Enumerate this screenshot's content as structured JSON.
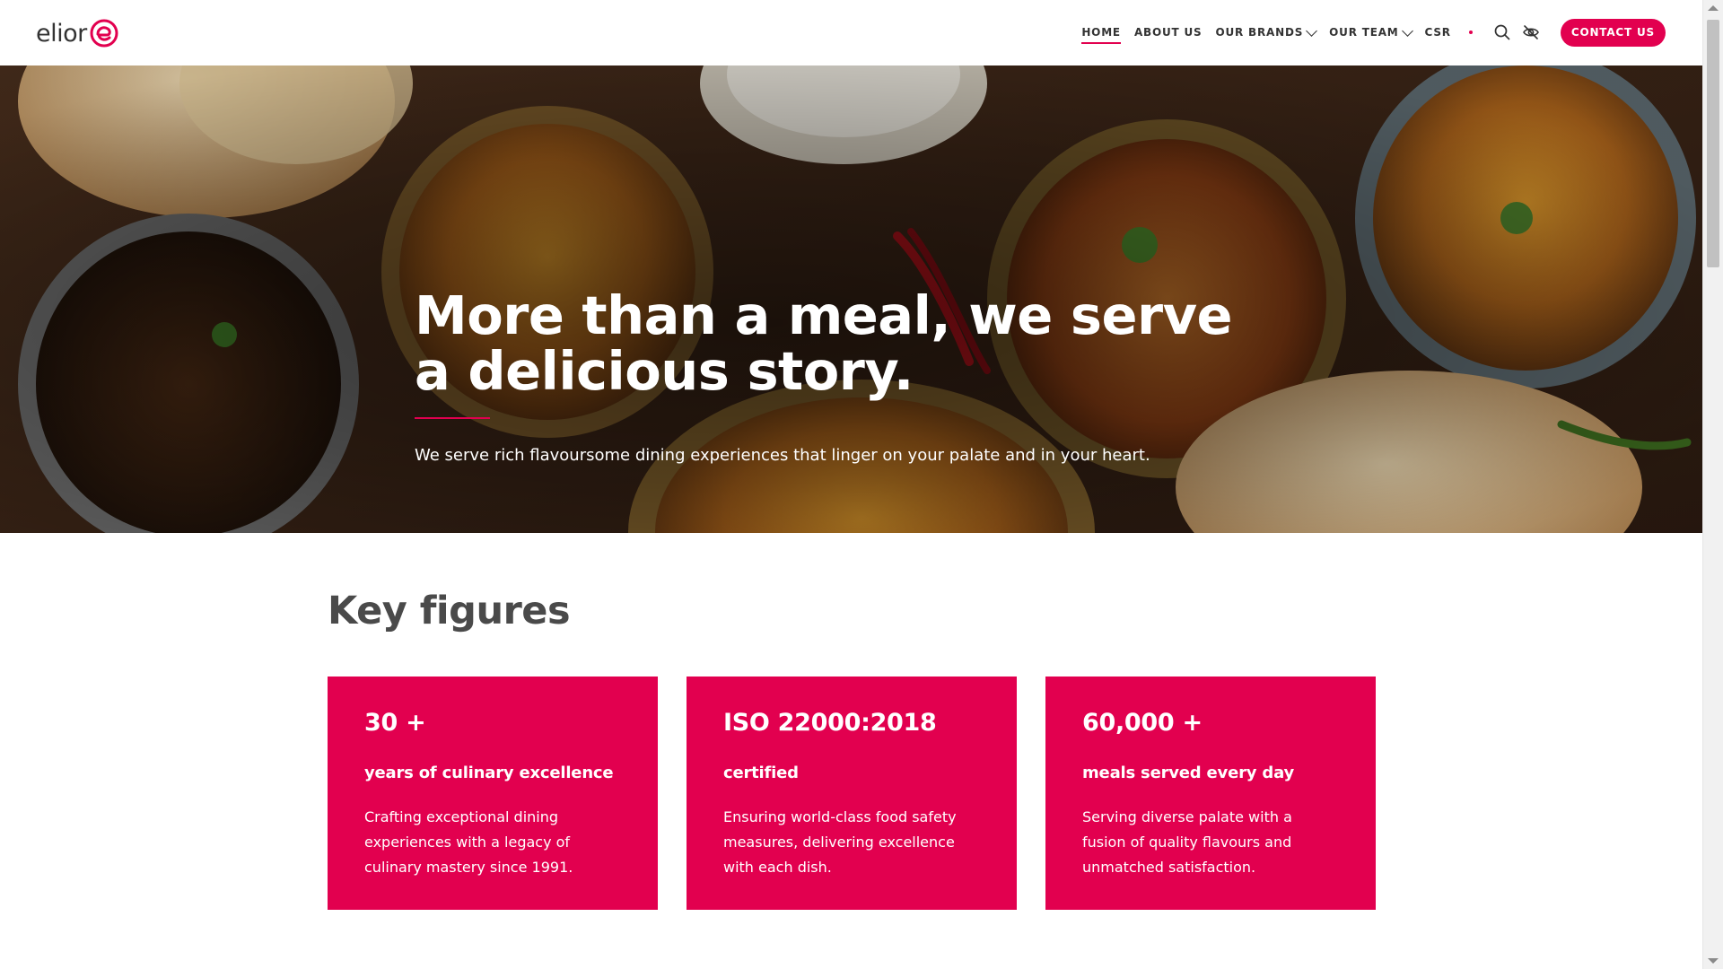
{
  "header": {
    "logo_text": "elior",
    "nav": [
      {
        "label": "HOME",
        "active": true
      },
      {
        "label": "ABOUT US"
      },
      {
        "label": "OUR BRANDS",
        "dropdown": true
      },
      {
        "label": "OUR TEAM",
        "dropdown": true
      },
      {
        "label": "CSR"
      }
    ],
    "icons": [
      "search-icon",
      "eye-off-icon"
    ],
    "cta_label": "CONTACT US"
  },
  "hero": {
    "title": "More than a meal, we serve a delicious story.",
    "subtitle": "We serve rich flavoursome dining experiences that linger on your palate and in your heart."
  },
  "key_figures": {
    "title": "Key figures",
    "cards": [
      {
        "value": "30 +",
        "label": "years of culinary excellence",
        "text": "Crafting exceptional dining experiences with a legacy of culinary mastery since 1991."
      },
      {
        "value": "ISO 22000:2018",
        "label": "certified",
        "text": "Ensuring world-class food safety measures, delivering excellence with each dish."
      },
      {
        "value": "60,000 +",
        "label": "meals served every day",
        "text": "Serving diverse palate with a fusion of quality flavours and unmatched satisfaction."
      }
    ]
  },
  "colors": {
    "brand": "#e2004f",
    "text_dark": "#333333",
    "heading": "#4a4a4a"
  }
}
